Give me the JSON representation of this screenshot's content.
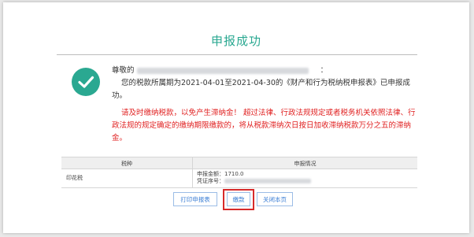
{
  "page": {
    "title": "申报成功"
  },
  "message": {
    "greeting_prefix": "尊敬的",
    "greeting_suffix": "：",
    "line1": "您的税款所属期为2021-04-01至2021-04-30的《财产和行为税纳税申报表》已申报成",
    "line2": "功。",
    "warning_line1": "请及时缴纳税款，以免产生滞纳金！ 超过法律、行政法规规定或者税务机关依照法律、行",
    "warning_line2": "政法规的规定确定的缴纳期限缴款的，将从税款滞纳次日按日加收滞纳税款万分之五的滞纳",
    "warning_line3": "金。"
  },
  "table": {
    "headers": [
      "税种",
      "申报情况"
    ],
    "rows": [
      {
        "tax_type": "印花税",
        "amount_label": "申报金额：1710.0",
        "voucher_label": "凭证序号："
      }
    ]
  },
  "buttons": {
    "print": "打印申报表",
    "pay": "缴款",
    "close": "关闭本页"
  },
  "colors": {
    "accent": "#2aa891",
    "warning": "#e02020",
    "button_text": "#3a7dd4",
    "highlight": "#d72a2a"
  },
  "icons": {
    "success": "check-circle-icon"
  }
}
